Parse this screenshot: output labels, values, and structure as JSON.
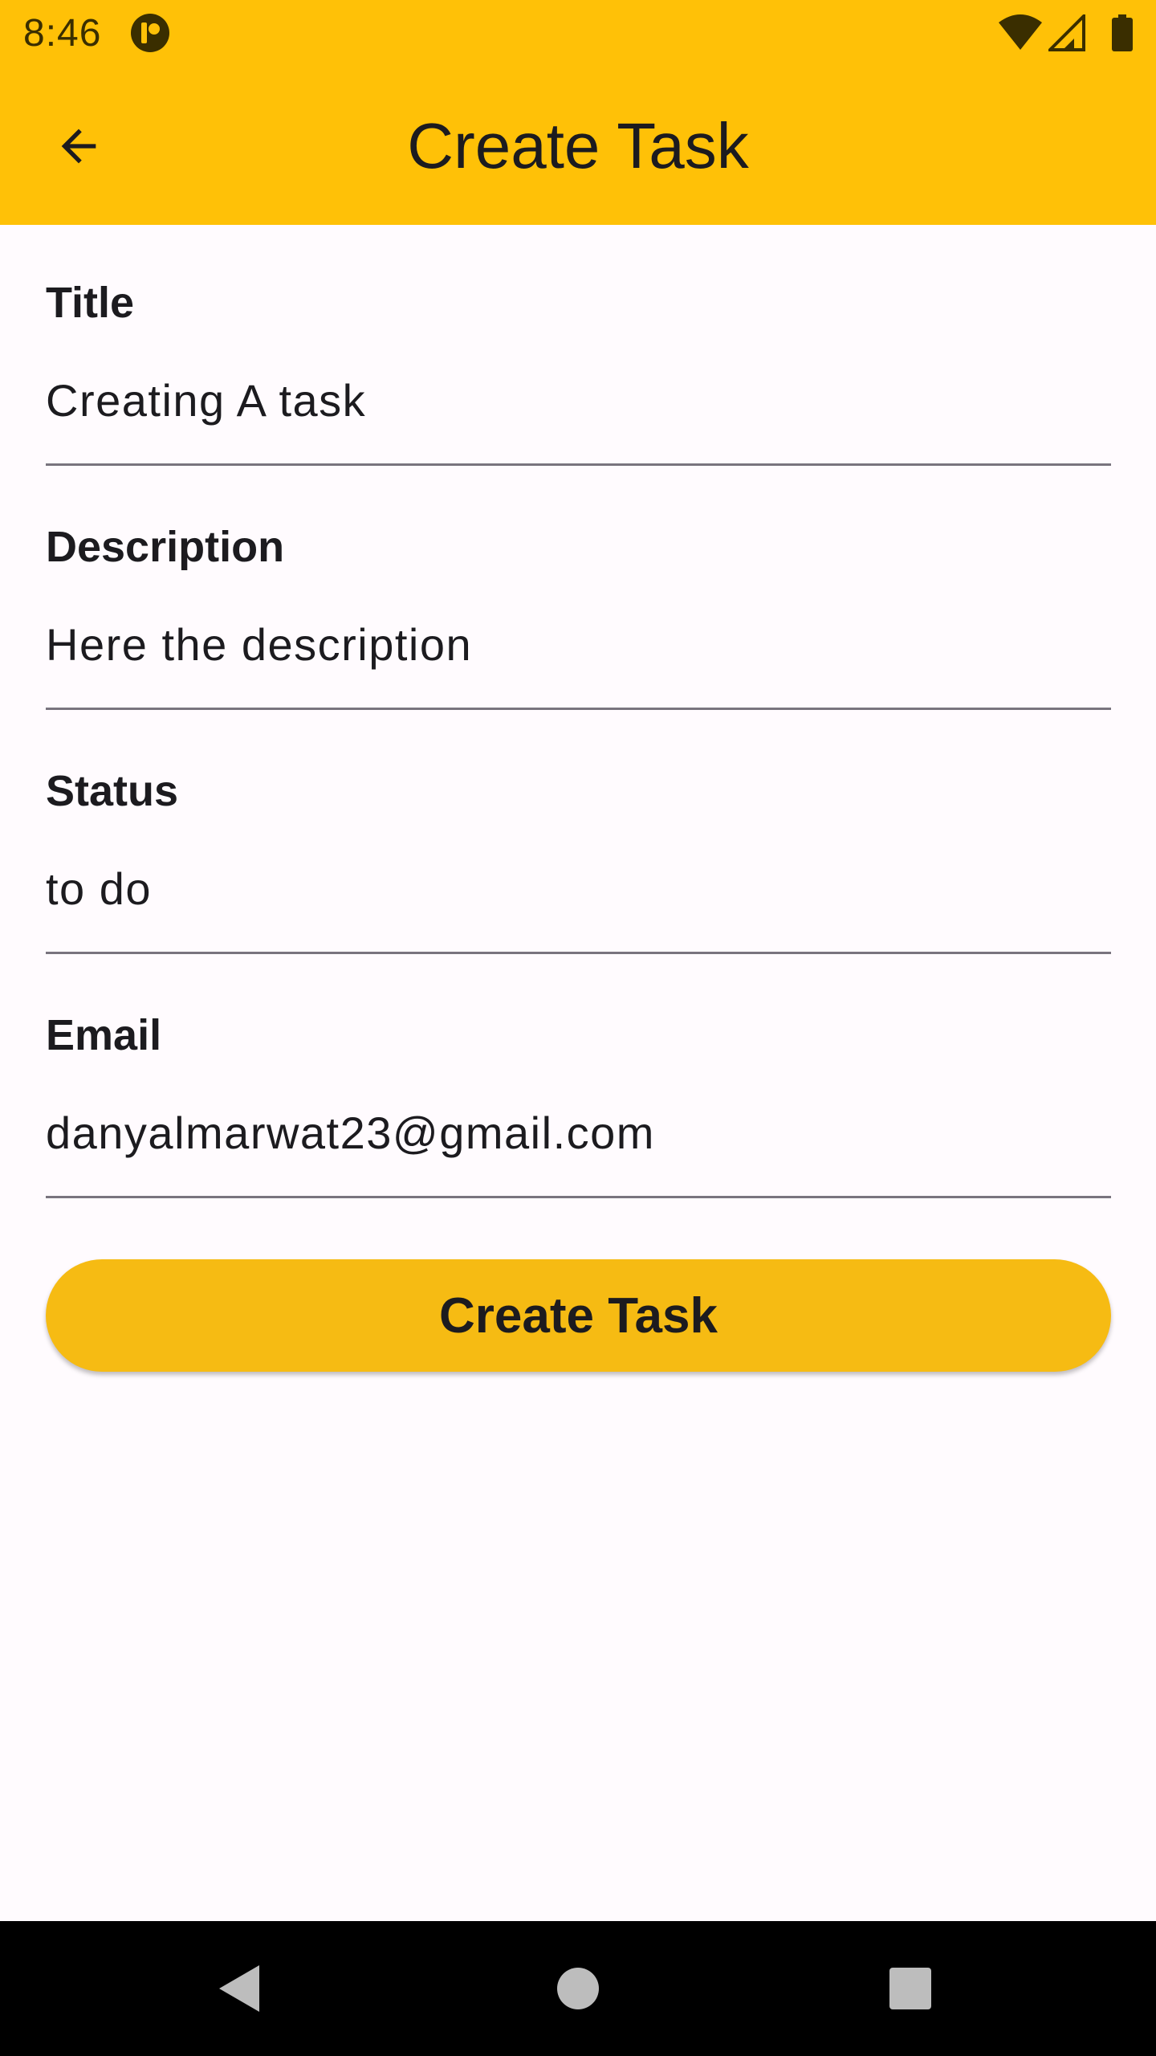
{
  "colors": {
    "accent": "#FFC107",
    "button": "#F6BB13",
    "nav_background": "#000000",
    "nav_icon": "#BDBDBD"
  },
  "status_bar": {
    "time": "8:46",
    "icons": [
      "app-notification-icon",
      "wifi-icon",
      "cellular-signal-icon",
      "battery-icon"
    ]
  },
  "app_bar": {
    "title": "Create Task",
    "back_icon": "arrow-back-icon"
  },
  "form": {
    "fields": [
      {
        "label": "Title",
        "value": "Creating A task"
      },
      {
        "label": "Description",
        "value": "Here the description"
      },
      {
        "label": "Status",
        "value": "to do"
      },
      {
        "label": "Email",
        "value": "danyalmarwat23@gmail.com"
      }
    ],
    "submit_label": "Create Task"
  },
  "nav_bar": {
    "icons": [
      "back-triangle-icon",
      "home-circle-icon",
      "recents-square-icon"
    ]
  }
}
